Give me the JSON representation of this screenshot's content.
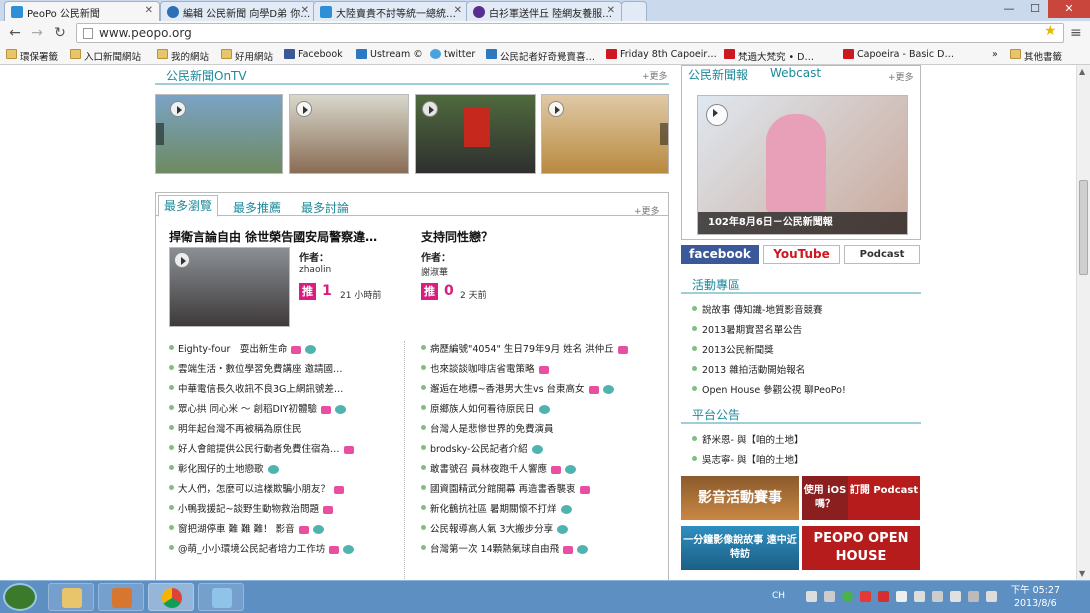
{
  "browser": {
    "tabs": [
      {
        "label": "PeoPo 公民新聞",
        "fav_color": "#2d8fd5"
      },
      {
        "label": "編輯 公民新聞 向學D弟 你…",
        "fav_color": "#2c6fb6"
      },
      {
        "label": "大陸賣貴不討等統一總統…",
        "fav_color": "#2d8fd5"
      },
      {
        "label": "白衫軍送伴丘 陸網友養服…",
        "fav_color": "#5a2d91"
      }
    ],
    "url": "www.peopo.org",
    "bookmarks": [
      "環保署籤",
      "入口新聞網站",
      "我的網站",
      "好用網站",
      "Facebook",
      "Ustream ©",
      "twitter",
      "公民記者好奇覺賣喜…",
      "Friday 8th Capoeir…",
      "梵過大梵究 • D…",
      "Capoeira - Basic D…",
      "»",
      "其他書籤"
    ]
  },
  "ontv": {
    "title": "公民新聞OnTV",
    "more": "+更多"
  },
  "popular": {
    "tabs": [
      "最多瀏覽",
      "最多推薦",
      "最多討論"
    ],
    "more": "+更多",
    "featured": [
      {
        "headline": "捍衛言論自由 徐世榮告國安局警察違…",
        "author_label": "作者：",
        "author": "zhaolin",
        "push_label": "推",
        "push_count": "1",
        "time": "21 小時前"
      },
      {
        "headline": "支持同性戀？",
        "author_label": "作者：",
        "author": "謝淑華",
        "push_label": "推",
        "push_count": "0",
        "time": "2 天前"
      }
    ],
    "left_list": [
      "Eighty-four　耍出新生命",
      "雲端生活・數位學習免費講座 邀請國…",
      "中華電信長久收訊不良3G上網訊號差…",
      "眾心拱 同心米 ～ 創稻DIY初體驗",
      "明年起台灣不再被稱為原住民",
      "好人會館提供公民行動者免費住宿為…",
      "彰化囤仔的土地戀歌",
      "大人們，怎麼可以這樣欺騙小朋友？",
      "小鴨我援記~談野生動物救治問題",
      "窗把湖停車 難 難 難！ 影音",
      "@萌_小小環境公民記者培力工作坊"
    ],
    "right_list": [
      "病歷編號\"4054\" 生日79年9月 姓名 洪仲丘",
      "也來談談咖啡店省電策略",
      "邂逅在地標~香港男大生vs 台東高女",
      "原鄉族人如何看待原民日",
      "台灣人是悲慘世界的免費演員",
      "brodsky-公民記者介紹",
      "敢書號召 員林夜跑千人響應",
      "國資園精武分館開幕 再造書香襲衷",
      "新化鶴抗社區 暑期關懷不打烊",
      "公民報導高人氣 3大搬步分享",
      "台灣第一次 14顆熱氣球自由飛"
    ]
  },
  "sidebar": {
    "news_tabs": [
      "公民新聞報",
      "Webcast"
    ],
    "more": "+更多",
    "video_caption": "102年8月6日－公民新聞報",
    "sns": [
      "facebook",
      "YouTube",
      "Podcast"
    ],
    "events_title": "活動專區",
    "events": [
      "說故事 傳知識-地質影音競賽",
      "2013暑期實習名單公告",
      "2013公民新聞獎",
      "2013 雜拍活動開始報名",
      "Open House 參觀公視 聊PeoPo!"
    ],
    "platform_title": "平台公告",
    "platform": [
      "舒米恩- 與【咱的土地】",
      "吳志寧- 與【咱的土地】"
    ],
    "banners": [
      "影音活動賽事",
      "使用 iOS嗎？",
      "訂閱 Podcast",
      "一分鐘影像說故事 遠中近特訪",
      "PEOPO OPEN HOUSE"
    ]
  },
  "taskbar": {
    "lang": "CH",
    "time": "下午 05:27",
    "date": "2013/8/6"
  },
  "colors": {
    "accent": "#1c8a9a",
    "push": "#d91f7e"
  }
}
